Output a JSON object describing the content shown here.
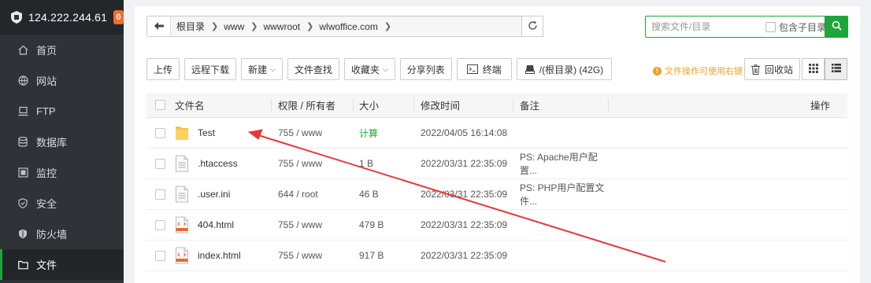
{
  "server": {
    "ip": "124.222.244.61",
    "badge": "0"
  },
  "sidebar": {
    "items": [
      {
        "label": "首页",
        "icon": "home-icon"
      },
      {
        "label": "网站",
        "icon": "globe-icon"
      },
      {
        "label": "FTP",
        "icon": "ftp-icon"
      },
      {
        "label": "数据库",
        "icon": "database-icon"
      },
      {
        "label": "监控",
        "icon": "monitor-icon"
      },
      {
        "label": "安全",
        "icon": "shield-check-icon"
      },
      {
        "label": "防火墙",
        "icon": "firewall-icon"
      },
      {
        "label": "文件",
        "icon": "folder-icon",
        "active": true
      }
    ]
  },
  "path": {
    "segments": [
      "根目录",
      "www",
      "wwwroot",
      "wlwoffice.com"
    ]
  },
  "search": {
    "placeholder": "搜索文件/目录",
    "include_sub_label": "包含子目录"
  },
  "toolbar": {
    "upload": "上传",
    "remote_download": "远程下载",
    "new": "新建",
    "file_search": "文件查找",
    "favorites": "收藏夹",
    "share_list": "分享列表",
    "terminal": "终端",
    "disk": "/(根目录) (42G)",
    "tip": "文件操作可使用右键",
    "recycle": "回收站"
  },
  "table": {
    "headers": {
      "name": "文件名",
      "perm": "权限 / 所有者",
      "size": "大小",
      "mtime": "修改时间",
      "note": "备注",
      "ops": "操作"
    },
    "rows": [
      {
        "name": "Test",
        "type": "folder",
        "perm": "755 / www",
        "size": "计算",
        "mtime": "2022/04/05 16:14:08",
        "note": ""
      },
      {
        "name": ".htaccess",
        "type": "file",
        "perm": "755 / www",
        "size": "1 B",
        "mtime": "2022/03/31 22:35:09",
        "note": "PS: Apache用户配置..."
      },
      {
        "name": ".user.ini",
        "type": "file",
        "perm": "644 / root",
        "size": "46 B",
        "mtime": "2022/03/31 22:35:09",
        "note": "PS: PHP用户配置文件..."
      },
      {
        "name": "404.html",
        "type": "html",
        "perm": "755 / www",
        "size": "479 B",
        "mtime": "2022/03/31 22:35:09",
        "note": ""
      },
      {
        "name": "index.html",
        "type": "html",
        "perm": "755 / www",
        "size": "917 B",
        "mtime": "2022/03/31 22:35:09",
        "note": ""
      }
    ]
  },
  "colors": {
    "accent": "#20a53a",
    "sidebar_bg": "#2f3337",
    "badge": "#f56c2b",
    "tip": "#f0a020",
    "annotation": "#e53935"
  }
}
